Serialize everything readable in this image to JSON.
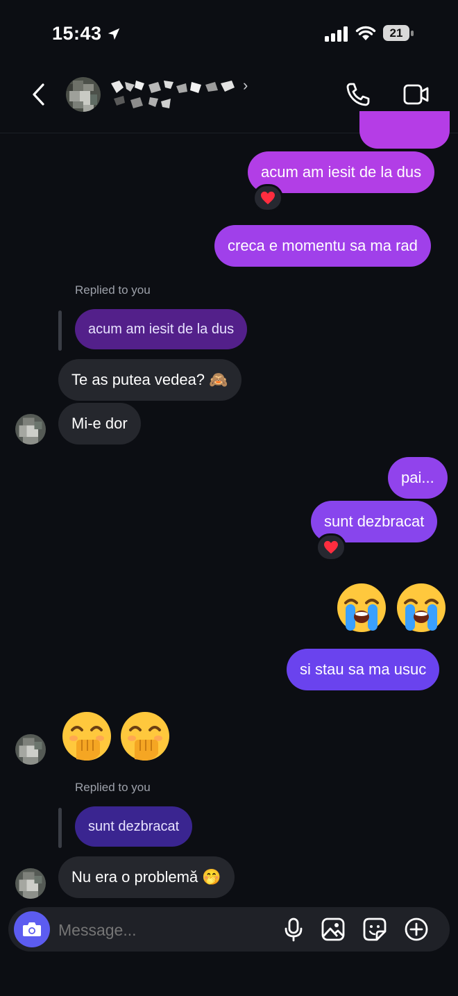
{
  "status_bar": {
    "time": "15:43",
    "battery": "21"
  },
  "header": {
    "contact_name": "",
    "chevron": "›"
  },
  "messages": {
    "m1_text": "acum am iesit de la dus",
    "m2_text": "creca e momentu sa ma rad",
    "reply1_label": "Replied to you",
    "reply1_quote": "acum am iesit de la dus",
    "m3_text": "Te as putea vedea? 🙈",
    "m4_text": "Mi-e dor",
    "m5_text": "pai...",
    "m6_text": "sunt dezbracat",
    "m8_text": "si stau sa ma usuc",
    "reply2_label": "Replied to you",
    "reply2_quote": "sunt dezbracat",
    "m10_text": "Nu era o problemă 🤭"
  },
  "reactions": [
    "heart",
    "heart"
  ],
  "emoji_messages": [
    {
      "side": "outgoing",
      "emoji": [
        "loudly-crying-face",
        "loudly-crying-face"
      ]
    },
    {
      "side": "incoming",
      "emoji": [
        "face-with-hand-over-mouth",
        "face-with-hand-over-mouth"
      ]
    }
  ],
  "composer": {
    "placeholder": "Message..."
  },
  "icons": [
    "location-arrow-icon",
    "signal-icon",
    "wifi-icon",
    "battery-icon",
    "back-icon",
    "phone-icon",
    "video-icon",
    "camera-icon",
    "microphone-icon",
    "gallery-icon",
    "sticker-icon",
    "plus-icon"
  ],
  "colors": {
    "background": "#0c0e13",
    "incoming_bubble": "#25272d",
    "outgoing_top": "#b23ee6",
    "outgoing_mid": "#8c45ec",
    "outgoing_bottom": "#6a43ee",
    "camera_button": "#5c5cf0"
  }
}
